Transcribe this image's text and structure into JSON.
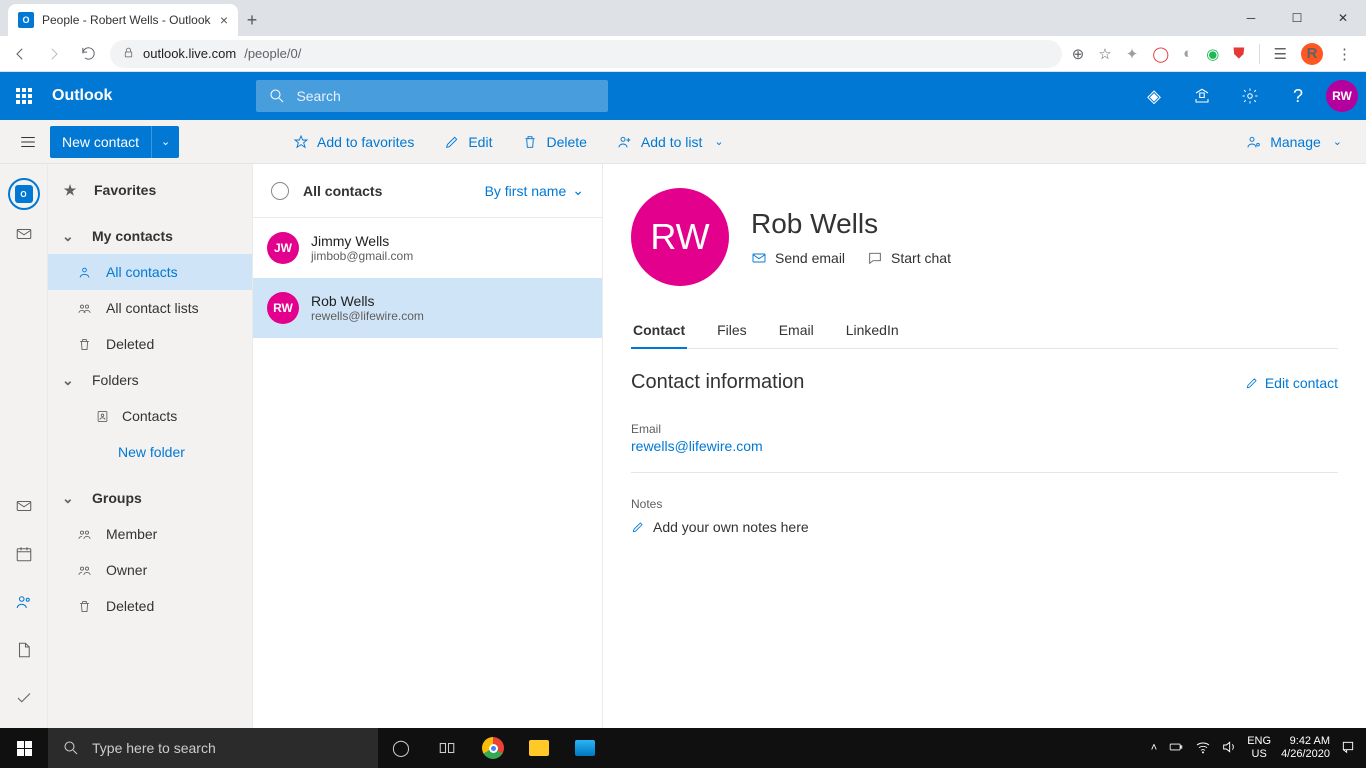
{
  "browser": {
    "tab_title": "People - Robert Wells - Outlook",
    "url_host": "outlook.live.com",
    "url_path": "/people/0/",
    "profile_initial": "R"
  },
  "header": {
    "brand": "Outlook",
    "search_placeholder": "Search",
    "avatar_initials": "RW"
  },
  "cmdbar": {
    "new_contact": "New contact",
    "add_favorites": "Add to favorites",
    "edit": "Edit",
    "delete": "Delete",
    "add_to_list": "Add to list",
    "manage": "Manage"
  },
  "nav": {
    "favorites": "Favorites",
    "my_contacts": "My contacts",
    "all_contacts": "All contacts",
    "all_contact_lists": "All contact lists",
    "deleted": "Deleted",
    "folders": "Folders",
    "contacts": "Contacts",
    "new_folder": "New folder",
    "groups": "Groups",
    "member": "Member",
    "owner": "Owner",
    "deleted2": "Deleted"
  },
  "list": {
    "title": "All contacts",
    "sort": "By first name",
    "contacts": [
      {
        "initials": "JW",
        "name": "Jimmy Wells",
        "email": "jimbob@gmail.com",
        "color": "#e3008c"
      },
      {
        "initials": "RW",
        "name": "Rob Wells",
        "email": "rewells@lifewire.com",
        "color": "#e3008c"
      }
    ]
  },
  "detail": {
    "avatar_initials": "RW",
    "name": "Rob Wells",
    "send_email": "Send email",
    "start_chat": "Start chat",
    "tabs": {
      "contact": "Contact",
      "files": "Files",
      "email": "Email",
      "linkedin": "LinkedIn"
    },
    "section_title": "Contact information",
    "edit_contact": "Edit contact",
    "email_label": "Email",
    "email_value": "rewells@lifewire.com",
    "notes_label": "Notes",
    "notes_placeholder": "Add your own notes here"
  },
  "taskbar": {
    "search_placeholder": "Type here to search",
    "lang1": "ENG",
    "lang2": "US",
    "time": "9:42 AM",
    "date": "4/26/2020"
  }
}
